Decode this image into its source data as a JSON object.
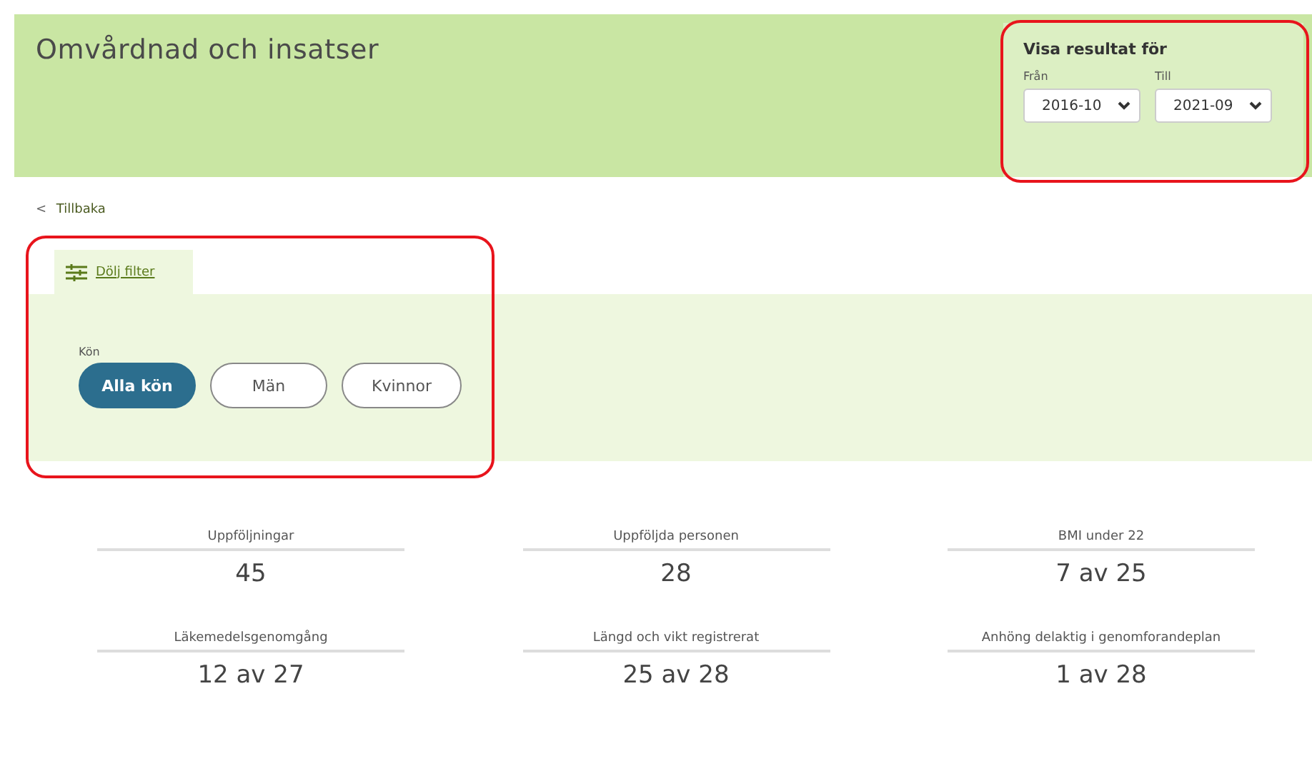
{
  "header": {
    "title": "Omvårdnad och insatser"
  },
  "period": {
    "title": "Visa resultat för",
    "from": {
      "label": "Från",
      "value": "2016-10"
    },
    "to": {
      "label": "Till",
      "value": "2021-09"
    }
  },
  "back_link": {
    "icon": "<",
    "label": "Tillbaka"
  },
  "filter": {
    "toggle_label": "Dölj filter",
    "group_label": "Kön",
    "options": [
      {
        "label": "Alla kön",
        "selected": true
      },
      {
        "label": "Män",
        "selected": false
      },
      {
        "label": "Kvinnor",
        "selected": false
      }
    ]
  },
  "stats": [
    {
      "label": "Uppföljningar",
      "value": "45"
    },
    {
      "label": "Uppföljda personen",
      "value": "28"
    },
    {
      "label": "BMI under 22",
      "value": "7 av 25"
    },
    {
      "label": "Läkemedelsgenomgång",
      "value": "12 av 27"
    },
    {
      "label": "Längd och vikt registrerat",
      "value": "25 av 28"
    },
    {
      "label": "Anhöng delaktig i genomforandeplan",
      "value": "1 av 28"
    }
  ]
}
